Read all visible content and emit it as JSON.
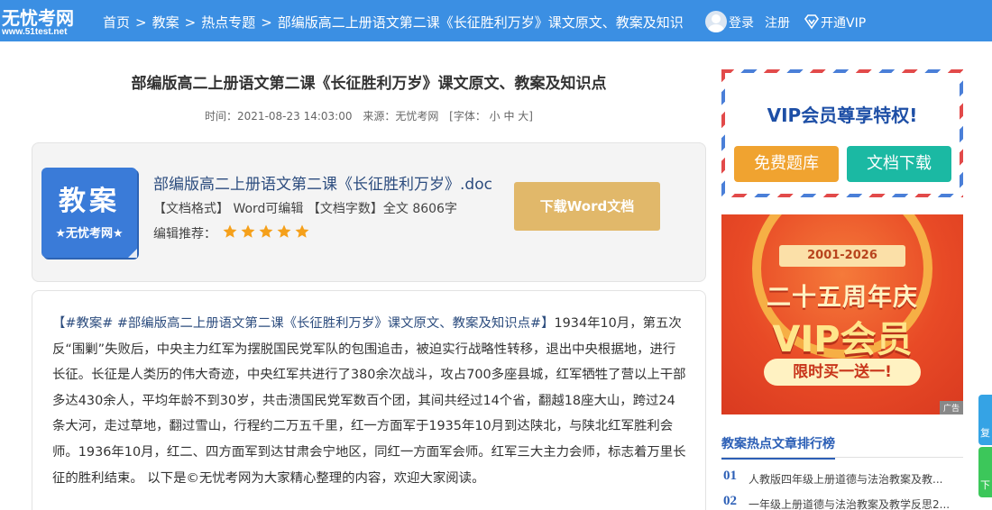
{
  "header": {
    "logo_main": "无忧考网",
    "logo_sub": "www.51test.net",
    "breadcrumbs": [
      "首页",
      "教案",
      "热点专题",
      "部编版高二上册语文第二课《长征胜利万岁》课文原文、教案及知识"
    ],
    "breadcrumb_sep": ">",
    "login": "登录",
    "register": "注册",
    "open_vip": "开通VIP"
  },
  "article": {
    "title": "部编版高二上册语文第二课《长征胜利万岁》课文原文、教案及知识点",
    "time_label": "时间：2021-08-23 14:03:00",
    "source_label": "来源：无忧考网",
    "font_label": "[字体： 小 中 大]",
    "body_tags": "【#教案# #部编版高二上册语文第二课《长征胜利万岁》课文原文、教案及知识点#】",
    "body_text": "1934年10月，第五次反“围剿”失败后，中央主力红军为摆脱国民党军队的包围追击，被迫实行战略性转移，退出中央根据地，进行长征。长征是人类历的伟大奇迹，中央红军共进行了380余次战斗，攻占700多座县城，红军牺牲了营以上干部多达430余人，平均年龄不到30岁，共击溃国民党军数百个团，其间共经过14个省，翻越18座大山，跨过24条大河，走过草地，翻过雪山，行程约二万五千里，红一方面军于1935年10月到达陕北，与陕北红军胜利会师。1936年10月，红二、四方面军到达甘肃会宁地区，同红一方面军会师。红军三大主力会师，标志着万里长征的胜利结束。 以下是©无忧考网为大家精心整理的内容，欢迎大家阅读。"
  },
  "download": {
    "icon_big": "教案",
    "icon_small": "★无忧考网★",
    "file_name": "部编版高二上册语文第二课《长征胜利万岁》.doc",
    "file_info": "【文档格式】 Word可编辑 【文档字数】全文 8606字",
    "recommend_label": "编辑推荐：",
    "stars": 5,
    "star_color": "#f5a01a",
    "button": "下载Word文档"
  },
  "vip_card": {
    "title": "VIP会员尊享特权!",
    "btn_questions": "免费题库",
    "btn_docs": "文档下载"
  },
  "ad": {
    "years": "2001-2026",
    "line1": "二十五周年庆",
    "line2": "VIP会员",
    "cta": "限时买一送一!",
    "label": "广告"
  },
  "ranking": {
    "title": "教案热点文章排行榜",
    "items": [
      {
        "num": "01",
        "text": "人教版四年级上册道德与法治教案及教..."
      },
      {
        "num": "02",
        "text": "一年级上册道德与法治教案及教学反思2..."
      }
    ]
  },
  "float_tabs": [
    "复",
    "下"
  ],
  "colors": {
    "header_bg": "#3b8fe3",
    "accent_blue": "#2c4c7e",
    "download_btn": "#e1b86a",
    "vip_orange": "#f0a330",
    "vip_teal": "#1bb9a3"
  }
}
